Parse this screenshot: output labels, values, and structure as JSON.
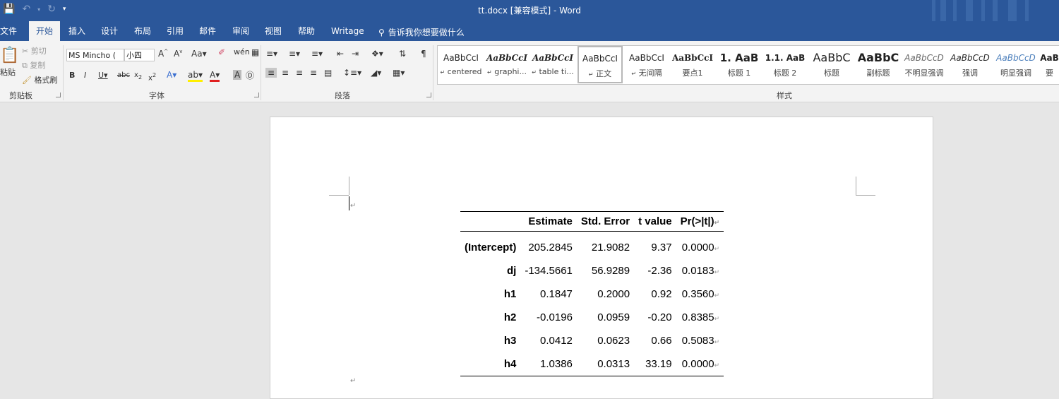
{
  "titlebar": {
    "title": "tt.docx [兼容模式]  -  Word"
  },
  "tabs": [
    "文件",
    "开始",
    "插入",
    "设计",
    "布局",
    "引用",
    "邮件",
    "审阅",
    "视图",
    "帮助",
    "Writage"
  ],
  "active_tab": "开始",
  "tell_me": "告诉我你想要做什么",
  "clipboard": {
    "paste": "粘贴",
    "cut": "剪切",
    "copy": "复制",
    "format_painter": "格式刷",
    "label": "剪贴板"
  },
  "font": {
    "name": "MS Mincho (",
    "size": "小四",
    "label": "字体"
  },
  "paragraph": {
    "label": "段落"
  },
  "styles": {
    "label": "样式",
    "items": [
      {
        "preview": "AaBbCcI",
        "name": "centered"
      },
      {
        "preview": "AaBbCcI",
        "name": "graphi..."
      },
      {
        "preview": "AaBbCcI",
        "name": "table ti..."
      },
      {
        "preview": "AaBbCcI",
        "name": "正文"
      },
      {
        "preview": "AaBbCcI",
        "name": "无间隔"
      },
      {
        "preview": "AaBbCcI",
        "name": "要点1"
      },
      {
        "preview": "1.  AaB",
        "name": "标题 1"
      },
      {
        "preview": "1.1.  AaB",
        "name": "标题 2"
      },
      {
        "preview": "AaBbC",
        "name": "标题"
      },
      {
        "preview": "AaBbC",
        "name": "副标题"
      },
      {
        "preview": "AaBbCcD",
        "name": "不明显强调"
      },
      {
        "preview": "AaBbCcD",
        "name": "强调"
      },
      {
        "preview": "AaBbCcD",
        "name": "明显强调"
      },
      {
        "preview": "AaB",
        "name": "要"
      }
    ]
  },
  "table": {
    "headers": [
      "",
      "Estimate",
      "Std. Error",
      "t value",
      "Pr(>|t|)"
    ],
    "rows": [
      [
        "(Intercept)",
        "205.2845",
        "21.9082",
        "9.37",
        "0.0000"
      ],
      [
        "dj",
        "-134.5661",
        "56.9289",
        "-2.36",
        "0.0183"
      ],
      [
        "h1",
        "0.1847",
        "0.2000",
        "0.92",
        "0.3560"
      ],
      [
        "h2",
        "-0.0196",
        "0.0959",
        "-0.20",
        "0.8385"
      ],
      [
        "h3",
        "0.0412",
        "0.0623",
        "0.66",
        "0.5083"
      ],
      [
        "h4",
        "1.0386",
        "0.0313",
        "33.19",
        "0.0000"
      ]
    ]
  },
  "colors": {
    "ribbon_blue": "#2b579a",
    "ribbon_bg": "#f3f3f3",
    "page_bg": "#e6e6e6"
  }
}
